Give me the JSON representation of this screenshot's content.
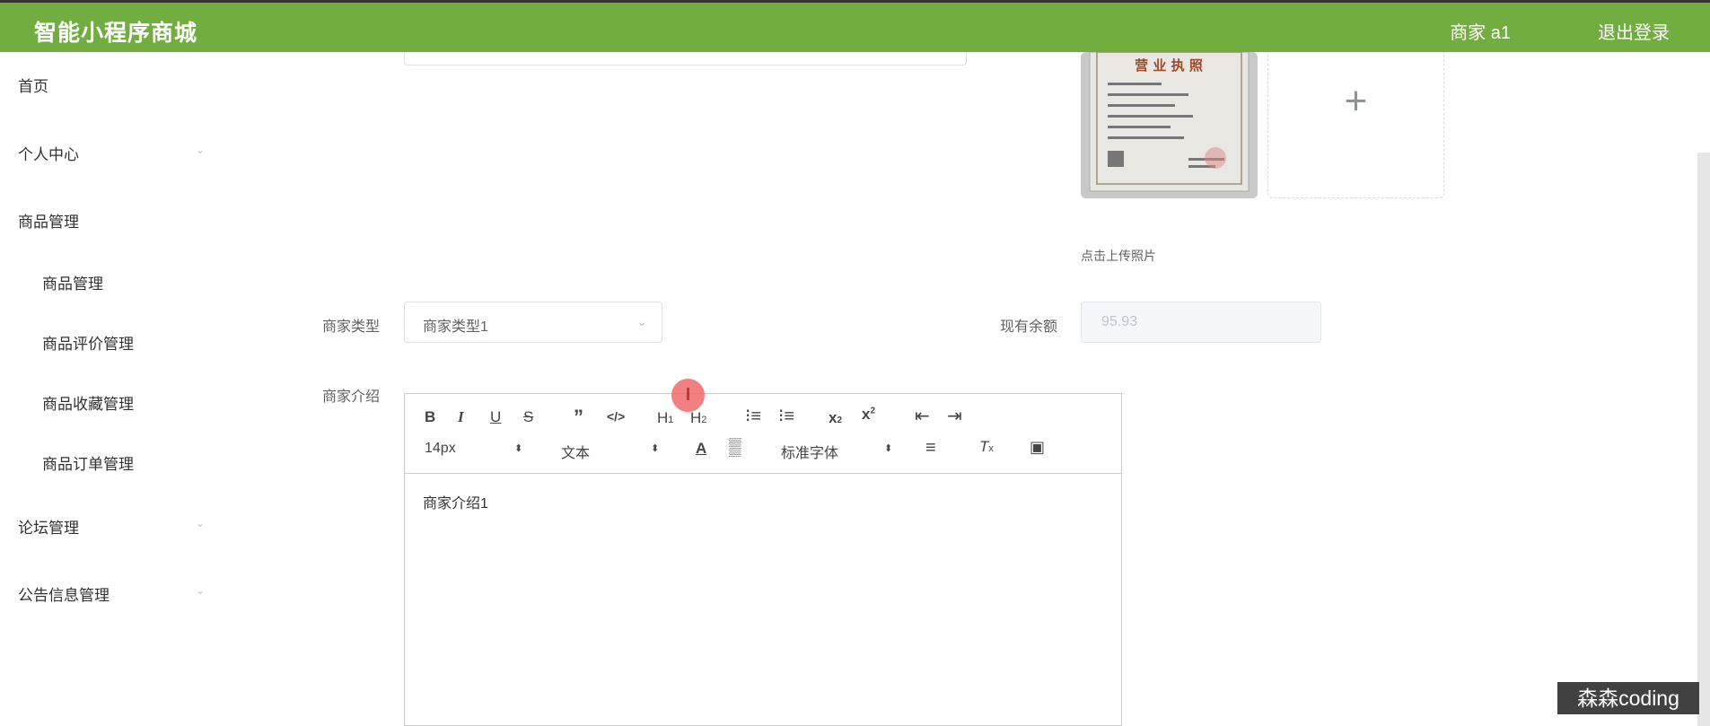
{
  "header": {
    "brand": "智能小程序商城",
    "user": "商家 a1",
    "logout": "退出登录",
    "color": "#72ad40"
  },
  "sidebar": {
    "items": [
      {
        "label": "首页"
      },
      {
        "label": "个人中心"
      },
      {
        "label": "商品管理"
      },
      {
        "label": "论坛管理"
      },
      {
        "label": "公告信息管理"
      }
    ],
    "sub_items": [
      {
        "label": "商品管理"
      },
      {
        "label": "商品评价管理"
      },
      {
        "label": "商品收藏管理"
      },
      {
        "label": "商品订单管理"
      }
    ]
  },
  "form": {
    "upload_tip": "点击上传照片",
    "merchant_type_label": "商家类型",
    "merchant_type_value": "商家类型1",
    "balance_label": "现有余额",
    "balance_value": "95.93",
    "intro_label": "商家介绍",
    "intro_content": "商家介绍1"
  },
  "editor": {
    "font_size": "14px",
    "paragraph": "文本",
    "font_family": "标准字体"
  },
  "license_image_text": "营 业 执 照",
  "watermark": "森森coding"
}
